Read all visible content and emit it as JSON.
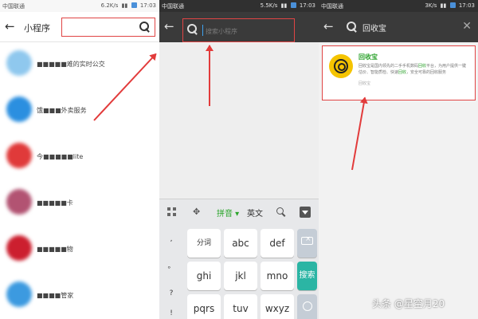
{
  "panel1": {
    "status": {
      "carrier": "中国联通",
      "speed": "6.2K/s",
      "time": "17:03"
    },
    "title": "小程序",
    "items": [
      {
        "label": "■■■■■难的实时公交",
        "color": "#8fc8ee"
      },
      {
        "label": "饿■■■外卖服务",
        "color": "#2b8fe0"
      },
      {
        "label": "今■■■■■lite",
        "color": "#e03a3a"
      },
      {
        "label": "■■■■■卡",
        "color": "#b25372"
      },
      {
        "label": "■■■■■物",
        "color": "#cc1f2f"
      },
      {
        "label": "■■■■管家",
        "color": "#3c9ae0"
      }
    ]
  },
  "panel2": {
    "status": {
      "carrier": "中国联通",
      "speed": "5.5K/s",
      "time": "17:03"
    },
    "search_placeholder": "搜索小程序",
    "keyboard": {
      "toolbar": {
        "mode": "拼音",
        "english": "英文"
      },
      "side": [
        ",",
        "。",
        "?",
        "!"
      ],
      "keys": [
        "分词",
        "abc",
        "def",
        "ghi",
        "jkl",
        "mno",
        "pqrs",
        "tuv",
        "wxyz"
      ],
      "search": "搜索"
    }
  },
  "panel3": {
    "status": {
      "carrier": "中国联通",
      "speed": "3K/s",
      "time": "17:03"
    },
    "query": "回收宝",
    "result": {
      "name": "回收宝",
      "desc_prefix": "回收宝是国内领先的二手手机数码",
      "desc_highlight": "回收",
      "desc_mid": "平台，为用户提供一键估价、智能质检、快速",
      "desc_highlight2": "回收",
      "desc_suffix": "，安全可靠的回收服务",
      "footer": "回收宝"
    }
  },
  "watermark": "头条 @星空月20",
  "colors": {
    "annotation_red": "#e23b3b",
    "keyboard_accent": "#2bb5a4",
    "brand_green": "#2ea32e",
    "logo_yellow": "#f5c400"
  }
}
